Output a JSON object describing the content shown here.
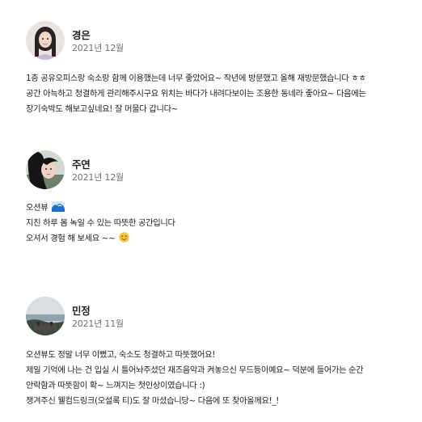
{
  "reviews": [
    {
      "name": "경은",
      "date": "2021년 12월",
      "lines": [
        "1층 공유오피스랑 숙소랑 함께 이용했는데 너무 좋았어요~ 작년에 방문했고 올해 재방문했습니다 ㅎㅎ",
        "공간 아늑하고 청결하게 관리해주시구요 위치는 바다가 내려다보이는 조용한 동네라 좋아요~ 다음에는",
        "장기숙박도 해보고싶네요! 잘 머물다 갑니다~"
      ],
      "avatar_icon": "profile-photo"
    },
    {
      "name": "주연",
      "date": "2021년 12월",
      "lines": [
        "오션뷰",
        "지친 하루 몸 녹일 수 있는 따뜻한 공간입니다",
        "오셔서 경험 해 보세요 ~~"
      ],
      "line_emojis": [
        "wave-emoji",
        "",
        "smiling-face-emoji"
      ],
      "avatar_icon": "profile-photo"
    },
    {
      "name": "민정",
      "date": "2021년 11월",
      "lines": [
        "오션뷰도 정말 너무 이뻤고, 숙소도 청결하고 따뜻했어요!",
        "제일 기억에 나는 건 입실 시 틀어놔주셨던 재즈음악과 켜놓으신 무드등이예요~ 덕분에 들어가는 순간",
        "안락함과 따뜻함이 확~ 느껴지는 첫인상이였습니다 :)",
        "챙겨주신 웰컴드링크(오설록 티)도 잘 마셨습니당~ 다음에 또 찾아올께요!_!"
      ],
      "avatar_icon": "profile-photo"
    }
  ],
  "colors": {
    "text": "#222222",
    "secondary_text": "#717171",
    "background": "#ffffff"
  }
}
